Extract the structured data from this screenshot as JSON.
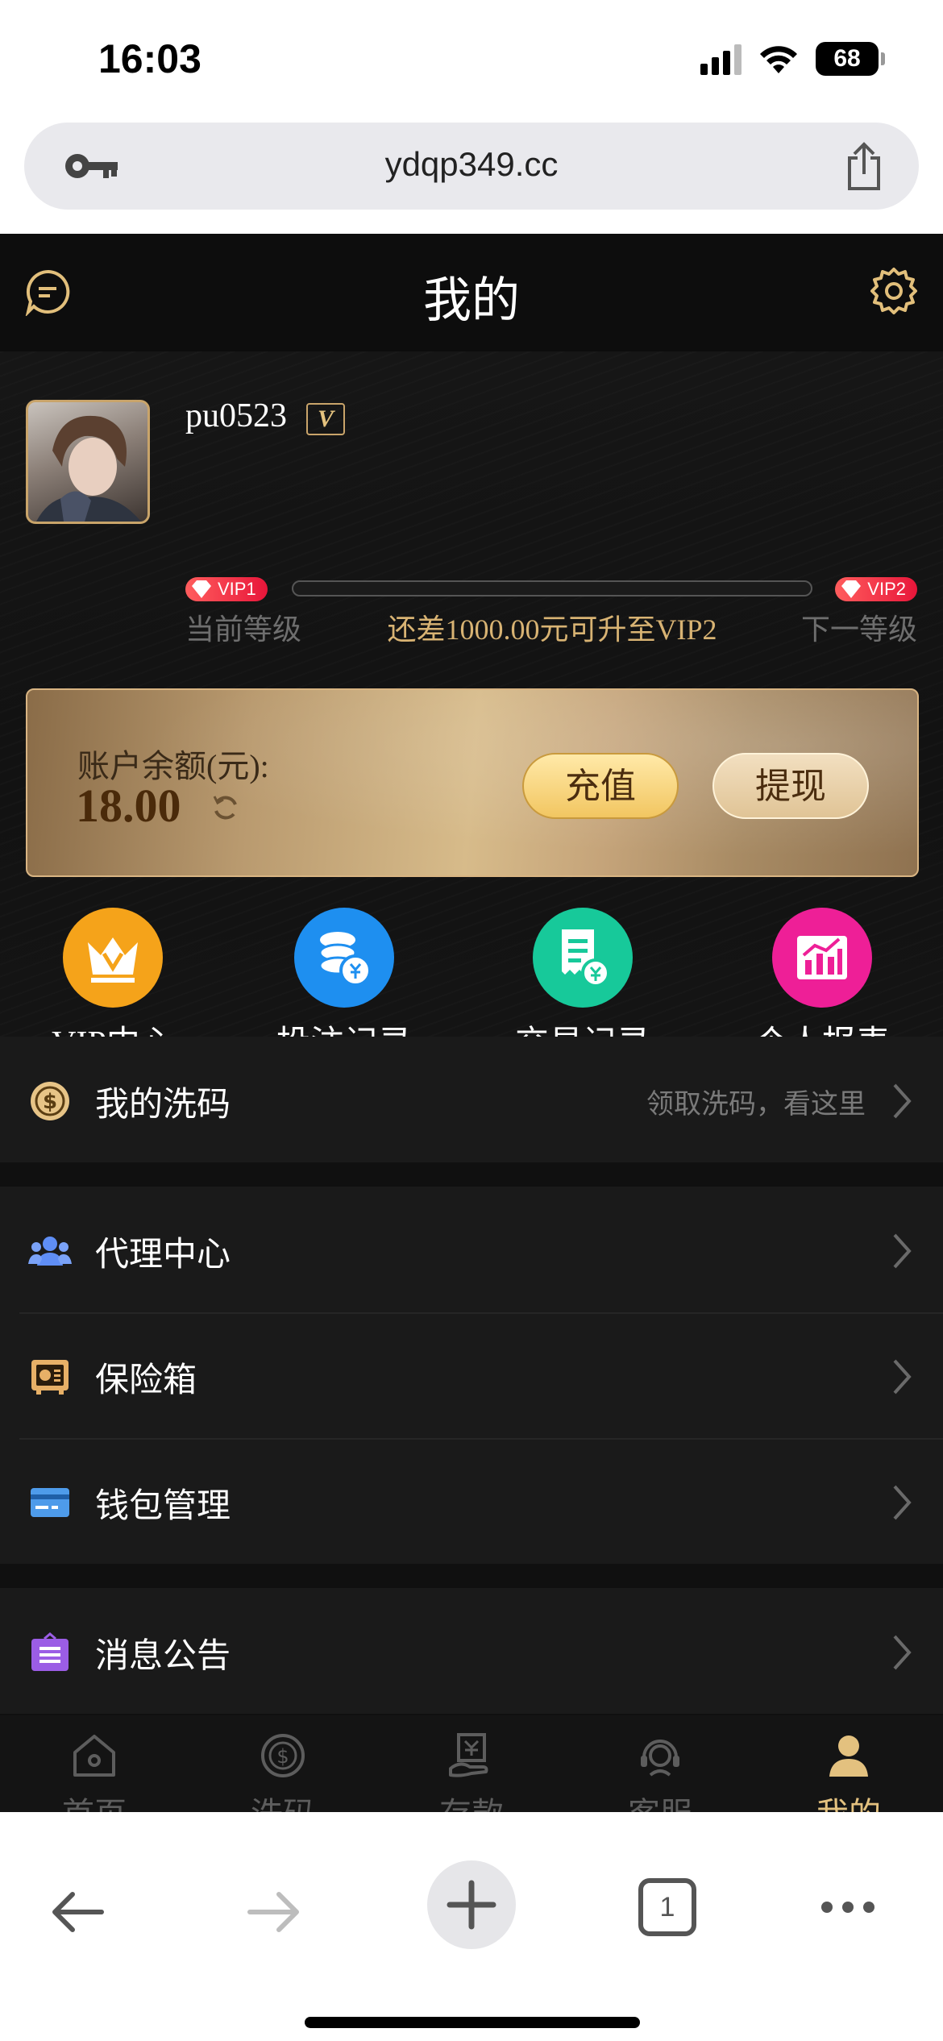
{
  "status_bar": {
    "time": "16:03",
    "battery": "68"
  },
  "browser": {
    "url": "ydqp349.cc",
    "tab_count": "1"
  },
  "header": {
    "title": "我的"
  },
  "profile": {
    "username": "pu0523",
    "badge": "V",
    "current_vip": "VIP1",
    "next_vip": "VIP2",
    "current_level_label": "当前等级",
    "next_level_label": "下一等级",
    "upgrade_hint": "还差1000.00元可升至VIP2",
    "progress": 0
  },
  "balance": {
    "label": "账户余额(元):",
    "value": "18.00",
    "deposit_label": "充值",
    "withdraw_label": "提现"
  },
  "quick_actions": [
    {
      "label": "VIP中心",
      "icon": "crown-icon",
      "color": "#f5a31a"
    },
    {
      "label": "投注记录",
      "icon": "coins-icon",
      "color": "#1e8ff0"
    },
    {
      "label": "交易记录",
      "icon": "receipt-icon",
      "color": "#17c99a"
    },
    {
      "label": "个人报表",
      "icon": "chart-icon",
      "color": "#ee1f97"
    }
  ],
  "menu": {
    "rebate": {
      "label": "我的洗码",
      "hint": "领取洗码，看这里"
    },
    "agent": {
      "label": "代理中心"
    },
    "safe": {
      "label": "保险箱"
    },
    "wallet": {
      "label": "钱包管理"
    },
    "notice": {
      "label": "消息公告"
    }
  },
  "tabs": [
    {
      "label": "首页",
      "icon": "home-icon"
    },
    {
      "label": "洗码",
      "icon": "rebate-icon"
    },
    {
      "label": "存款",
      "icon": "deposit-icon"
    },
    {
      "label": "客服",
      "icon": "support-icon"
    },
    {
      "label": "我的",
      "icon": "user-icon",
      "active": true
    }
  ],
  "colors": {
    "accent_gold": "#e3c17f",
    "background": "#101010"
  }
}
